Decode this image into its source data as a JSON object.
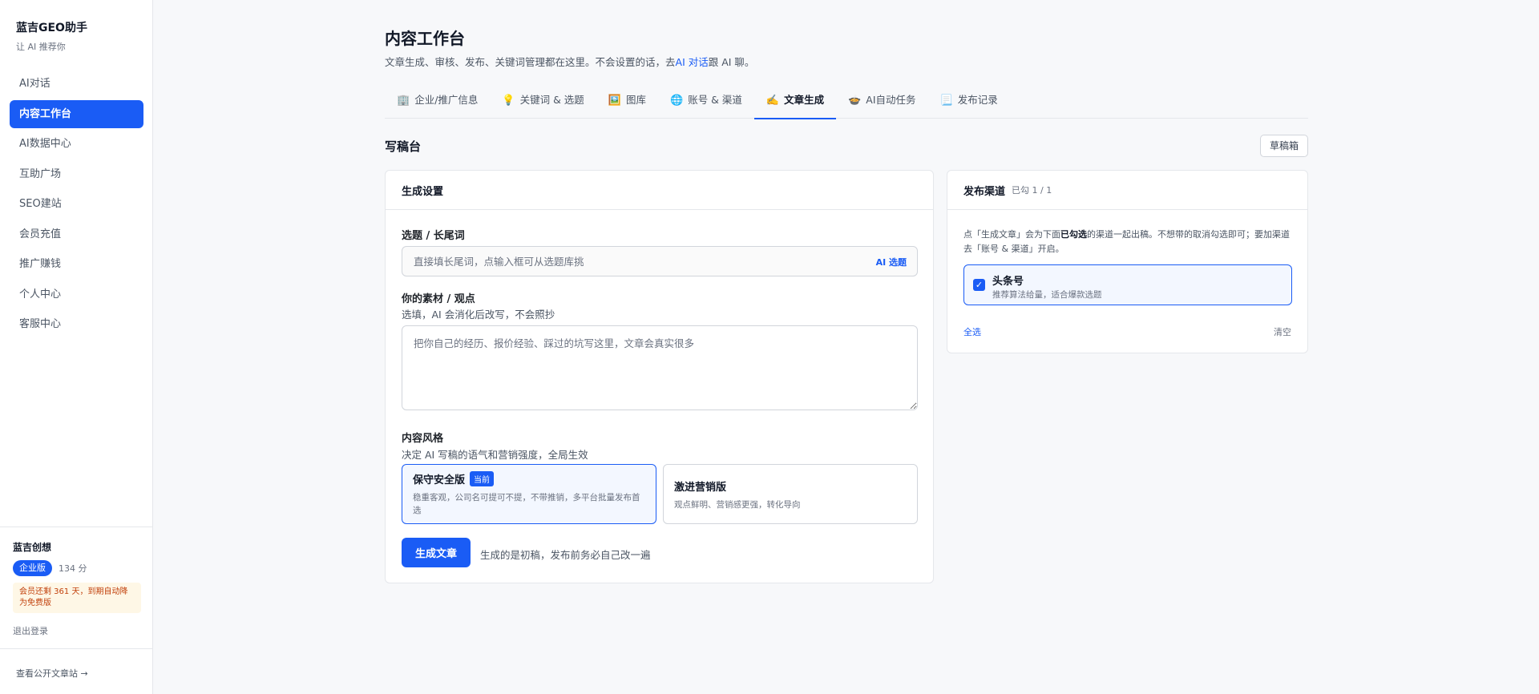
{
  "sidebar": {
    "brand_title": "蓝吉GEO助手",
    "brand_subtitle": "让 AI 推荐你",
    "items": [
      {
        "label": "AI对话",
        "active": false
      },
      {
        "label": "内容工作台",
        "active": true
      },
      {
        "label": "AI数据中心",
        "active": false
      },
      {
        "label": "互助广场",
        "active": false
      },
      {
        "label": "SEO建站",
        "active": false
      },
      {
        "label": "会员充值",
        "active": false
      },
      {
        "label": "推广赚钱",
        "active": false
      },
      {
        "label": "个人中心",
        "active": false
      },
      {
        "label": "客服中心",
        "active": false
      }
    ],
    "account": {
      "name": "蓝吉创想",
      "plan": "企业版",
      "points": "134 分",
      "expire_note": "会员还剩 361 天，到期自动降为免费版",
      "logout": "退出登录"
    },
    "public_link": "查看公开文章站 →"
  },
  "header": {
    "title": "内容工作台",
    "desc_before": "文章生成、审核、发布、关键词管理都在这里。不会设置的话，去",
    "desc_link": "AI 对话",
    "desc_after": "跟 AI 聊。"
  },
  "tabs": [
    {
      "icon": "🏢",
      "icon_name": "building-icon",
      "label": "企业/推广信息",
      "active": false
    },
    {
      "icon": "💡",
      "icon_name": "lightbulb-icon",
      "label": "关键词 & 选题",
      "active": false
    },
    {
      "icon": "🖼️",
      "icon_name": "picture-icon",
      "label": "图库",
      "active": false
    },
    {
      "icon": "🌐",
      "icon_name": "globe-icon",
      "label": "账号 & 渠道",
      "active": false
    },
    {
      "icon": "✍️",
      "icon_name": "writing-hand-icon",
      "label": "文章生成",
      "active": true
    },
    {
      "icon": "🍲",
      "icon_name": "pot-icon",
      "label": "AI自动任务",
      "active": false
    },
    {
      "icon": "📃",
      "icon_name": "page-icon",
      "label": "发布记录",
      "active": false
    }
  ],
  "workspace": {
    "title": "写稿台",
    "drafts_button": "草稿箱"
  },
  "generate": {
    "card_title": "生成设置",
    "topic_label": "选题 / 长尾词",
    "topic_placeholder": "直接填长尾词，点输入框可从选题库挑",
    "topic_value": "",
    "ai_pick": "AI 选题",
    "material_label": "你的素材 / 观点",
    "material_hint": "选填，AI 会消化后改写，不会照抄",
    "material_placeholder": "把你自己的经历、报价经验、踩过的坑写这里，文章会真实很多",
    "style_label": "内容风格",
    "style_hint": "决定 AI 写稿的语气和营销强度，全局生效",
    "styles": [
      {
        "title": "保守安全版",
        "badge": "当前",
        "desc": "稳重客观，公司名可提可不提，不带推销，多平台批量发布首选",
        "selected": true
      },
      {
        "title": "激进营销版",
        "badge": "",
        "desc": "观点鲜明、营销感更强，转化导向",
        "selected": false
      }
    ],
    "button": "生成文章",
    "note": "生成的是初稿，发布前务必自己改一遍"
  },
  "publish": {
    "card_title": "发布渠道",
    "checked_count": "已勾 1 / 1",
    "desc_part1": "点「生成文章」会为下面",
    "desc_bold": "已勾选",
    "desc_part2": "的渠道一起出稿。不想带的取消勾选即可；要加渠道去「账号 & 渠道」开启。",
    "channels": [
      {
        "name": "头条号",
        "desc": "推荐算法给量，适合爆款选题",
        "checked": true
      }
    ],
    "select_all": "全选",
    "clear": "清空"
  },
  "colors": {
    "accent": "#1a5cf5",
    "warning_bg": "#fef7e6",
    "warning_text": "#c2410c"
  }
}
